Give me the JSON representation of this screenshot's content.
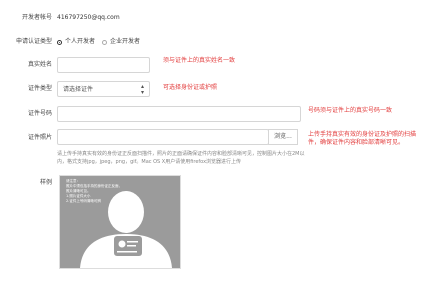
{
  "form": {
    "developer_account_label": "开发者帐号",
    "developer_account_value": "416797250@qq.com",
    "apply_type_label": "申请认证类型",
    "apply_type_options": [
      "个人开发者",
      "企业开发者"
    ],
    "apply_type_selected": "个人开发者",
    "real_name_label": "真实姓名",
    "real_name_value": "",
    "real_name_hint": "须与证件上的真实姓名一致",
    "id_type_label": "证件类型",
    "id_type_selected": "请选择证件",
    "id_type_hint": "可选择身份证或护照",
    "id_number_label": "证件号码",
    "id_number_value": "",
    "id_number_hint": "号码须与证件上的真实号码一致",
    "id_photo_label": "证件照片",
    "id_photo_value": "",
    "browse_label": "浏览...",
    "id_photo_hint": "上传手持真实有效的身份证及护照的扫描件，确保证件内容和脸部清晰可见。",
    "id_photo_note_line1": "请上传手持真实有效的身份证正反面扫描件，照片的正面请确保证件内容和脸部清晰可见，控制图片大小在2M以",
    "id_photo_note_line2": "内，格式支持jpg，jpeg，png，gif。Mac OS X用户请使用firefox浏览器进行上传",
    "sample_label": "样例",
    "sample_text": [
      "请注意：",
      "照片中须包括手持的身份证正反面，照片清晰可见。",
      "1.照片证件大小",
      "2.证件上号码清晰可辨"
    ]
  }
}
